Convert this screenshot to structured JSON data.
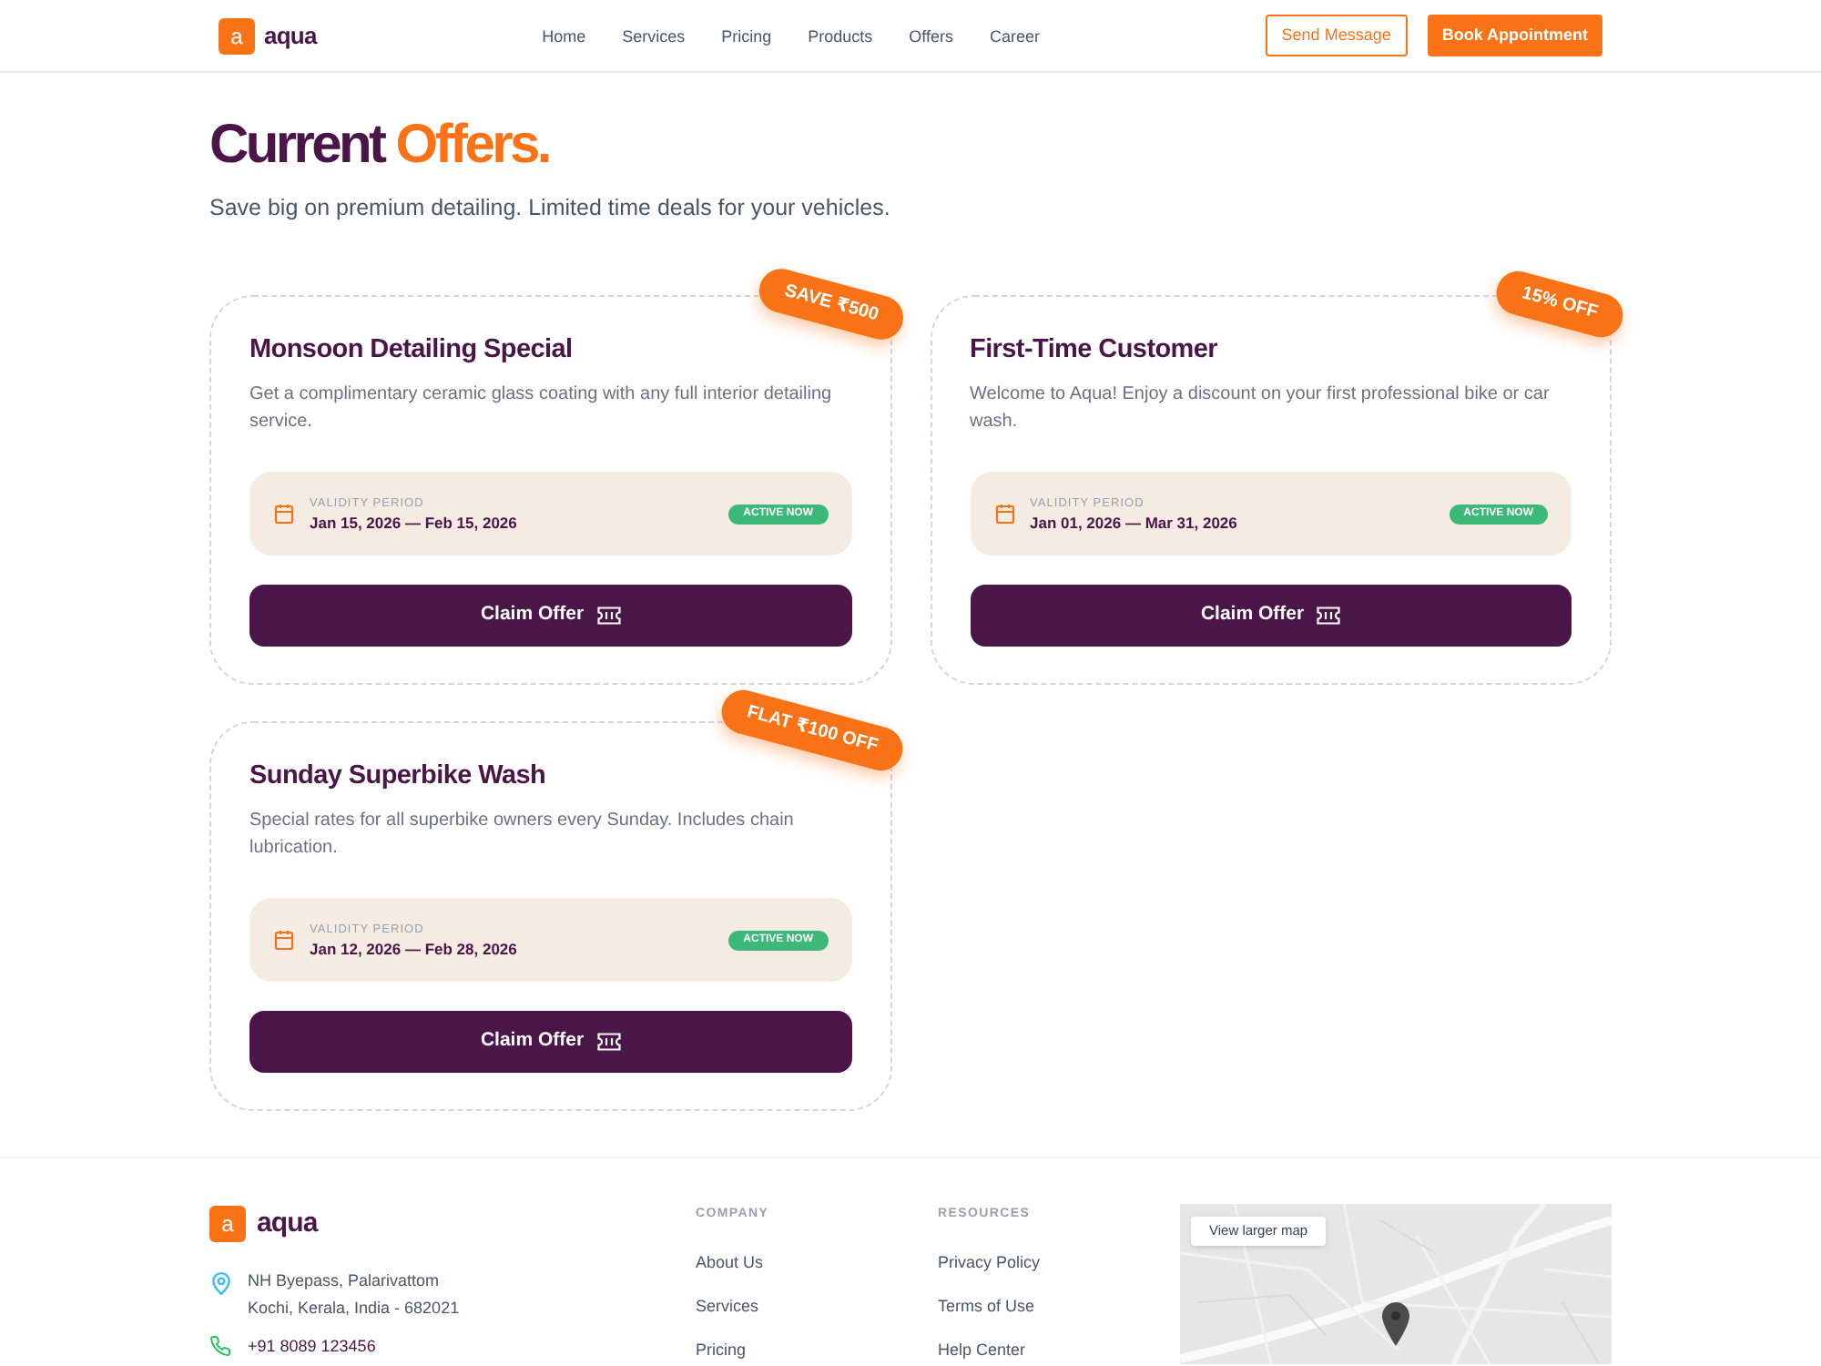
{
  "header": {
    "logo": {
      "mark": "a",
      "name": "aqua"
    },
    "nav": [
      "Home",
      "Services",
      "Pricing",
      "Products",
      "Offers",
      "Career"
    ],
    "buttons": [
      {
        "label": "Send Message",
        "kind": "outline"
      },
      {
        "label": "Book Appointment",
        "kind": "solid"
      }
    ]
  },
  "hero": {
    "title": "Current",
    "title_highlight": "Offers.",
    "subtitle": "Save big on premium detailing. Limited time deals for your vehicles."
  },
  "offers": [
    {
      "badge": "SAVE ₹500",
      "title": "Monsoon Detailing Special",
      "description": "Get a complimentary ceramic glass coating with any full interior detailing service.",
      "validity_label": "VALIDITY PERIOD",
      "validity": "Jan 15, 2026 — Feb 15, 2026",
      "status": "ACTIVE NOW",
      "button": "Claim Offer"
    },
    {
      "badge": "15% OFF",
      "title": "First-Time Customer",
      "description": "Welcome to Aqua! Enjoy a discount on your first professional bike or car wash.",
      "validity_label": "VALIDITY PERIOD",
      "validity": "Jan 01, 2026 — Mar 31, 2026",
      "status": "ACTIVE NOW",
      "button": "Claim Offer"
    },
    {
      "badge": "FLAT ₹100 OFF",
      "title": "Sunday Superbike Wash",
      "description": "Special rates for all superbike owners every Sunday. Includes chain lubrication.",
      "validity_label": "VALIDITY PERIOD",
      "validity": "Jan 12, 2026 — Feb 28, 2026",
      "status": "ACTIVE NOW",
      "button": "Claim Offer"
    }
  ],
  "footer": {
    "logo": {
      "mark": "a",
      "name": "aqua"
    },
    "address": [
      "NH Byepass, Palarivattom",
      "Kochi, Kerala, India - 682021"
    ],
    "phone": "+91 8089 123456",
    "columns": [
      {
        "heading": "COMPANY",
        "links": [
          "About Us",
          "Services",
          "Pricing"
        ]
      },
      {
        "heading": "RESOURCES",
        "links": [
          "Privacy Policy",
          "Terms of Use",
          "Help Center"
        ]
      }
    ],
    "map": {
      "button": "View larger map"
    }
  }
}
